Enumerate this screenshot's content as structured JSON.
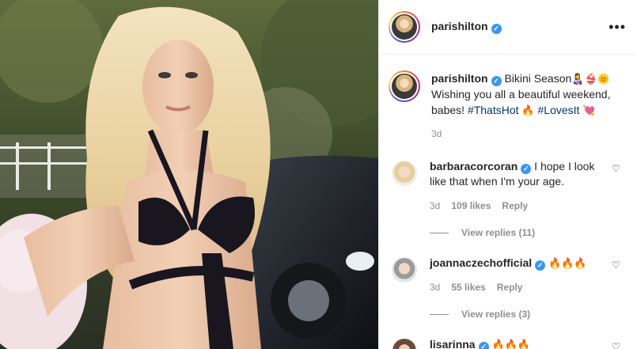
{
  "post": {
    "username": "parishilton",
    "verified_mark": "✓",
    "more_icon": "more-options-icon",
    "caption": {
      "text_start": "Bikini Season",
      "emojis_1": "👩‍🍼👙🌞",
      "line2": "Wishing you all a beautiful weekend, babes!",
      "hashtag1": "#ThatsHot",
      "emoji_fire": "🔥",
      "hashtag2": "#LovesIt",
      "emoji_heart": "💘",
      "time": "3d"
    }
  },
  "comments": [
    {
      "username": "barbaracorcoran",
      "text": "I hope I look like that when I'm your age.",
      "time": "3d",
      "likes": "109 likes",
      "reply": "Reply",
      "view_replies": "View replies (11)"
    },
    {
      "username": "joannaczechofficial",
      "text": "🔥🔥🔥",
      "time": "3d",
      "likes": "55 likes",
      "reply": "Reply",
      "view_replies": "View replies (3)"
    },
    {
      "username": "lisarinna",
      "text": "🔥🔥🔥"
    }
  ],
  "colors": {
    "link": "#00376b",
    "muted": "#8e8e8e",
    "verified": "#3897f0"
  }
}
